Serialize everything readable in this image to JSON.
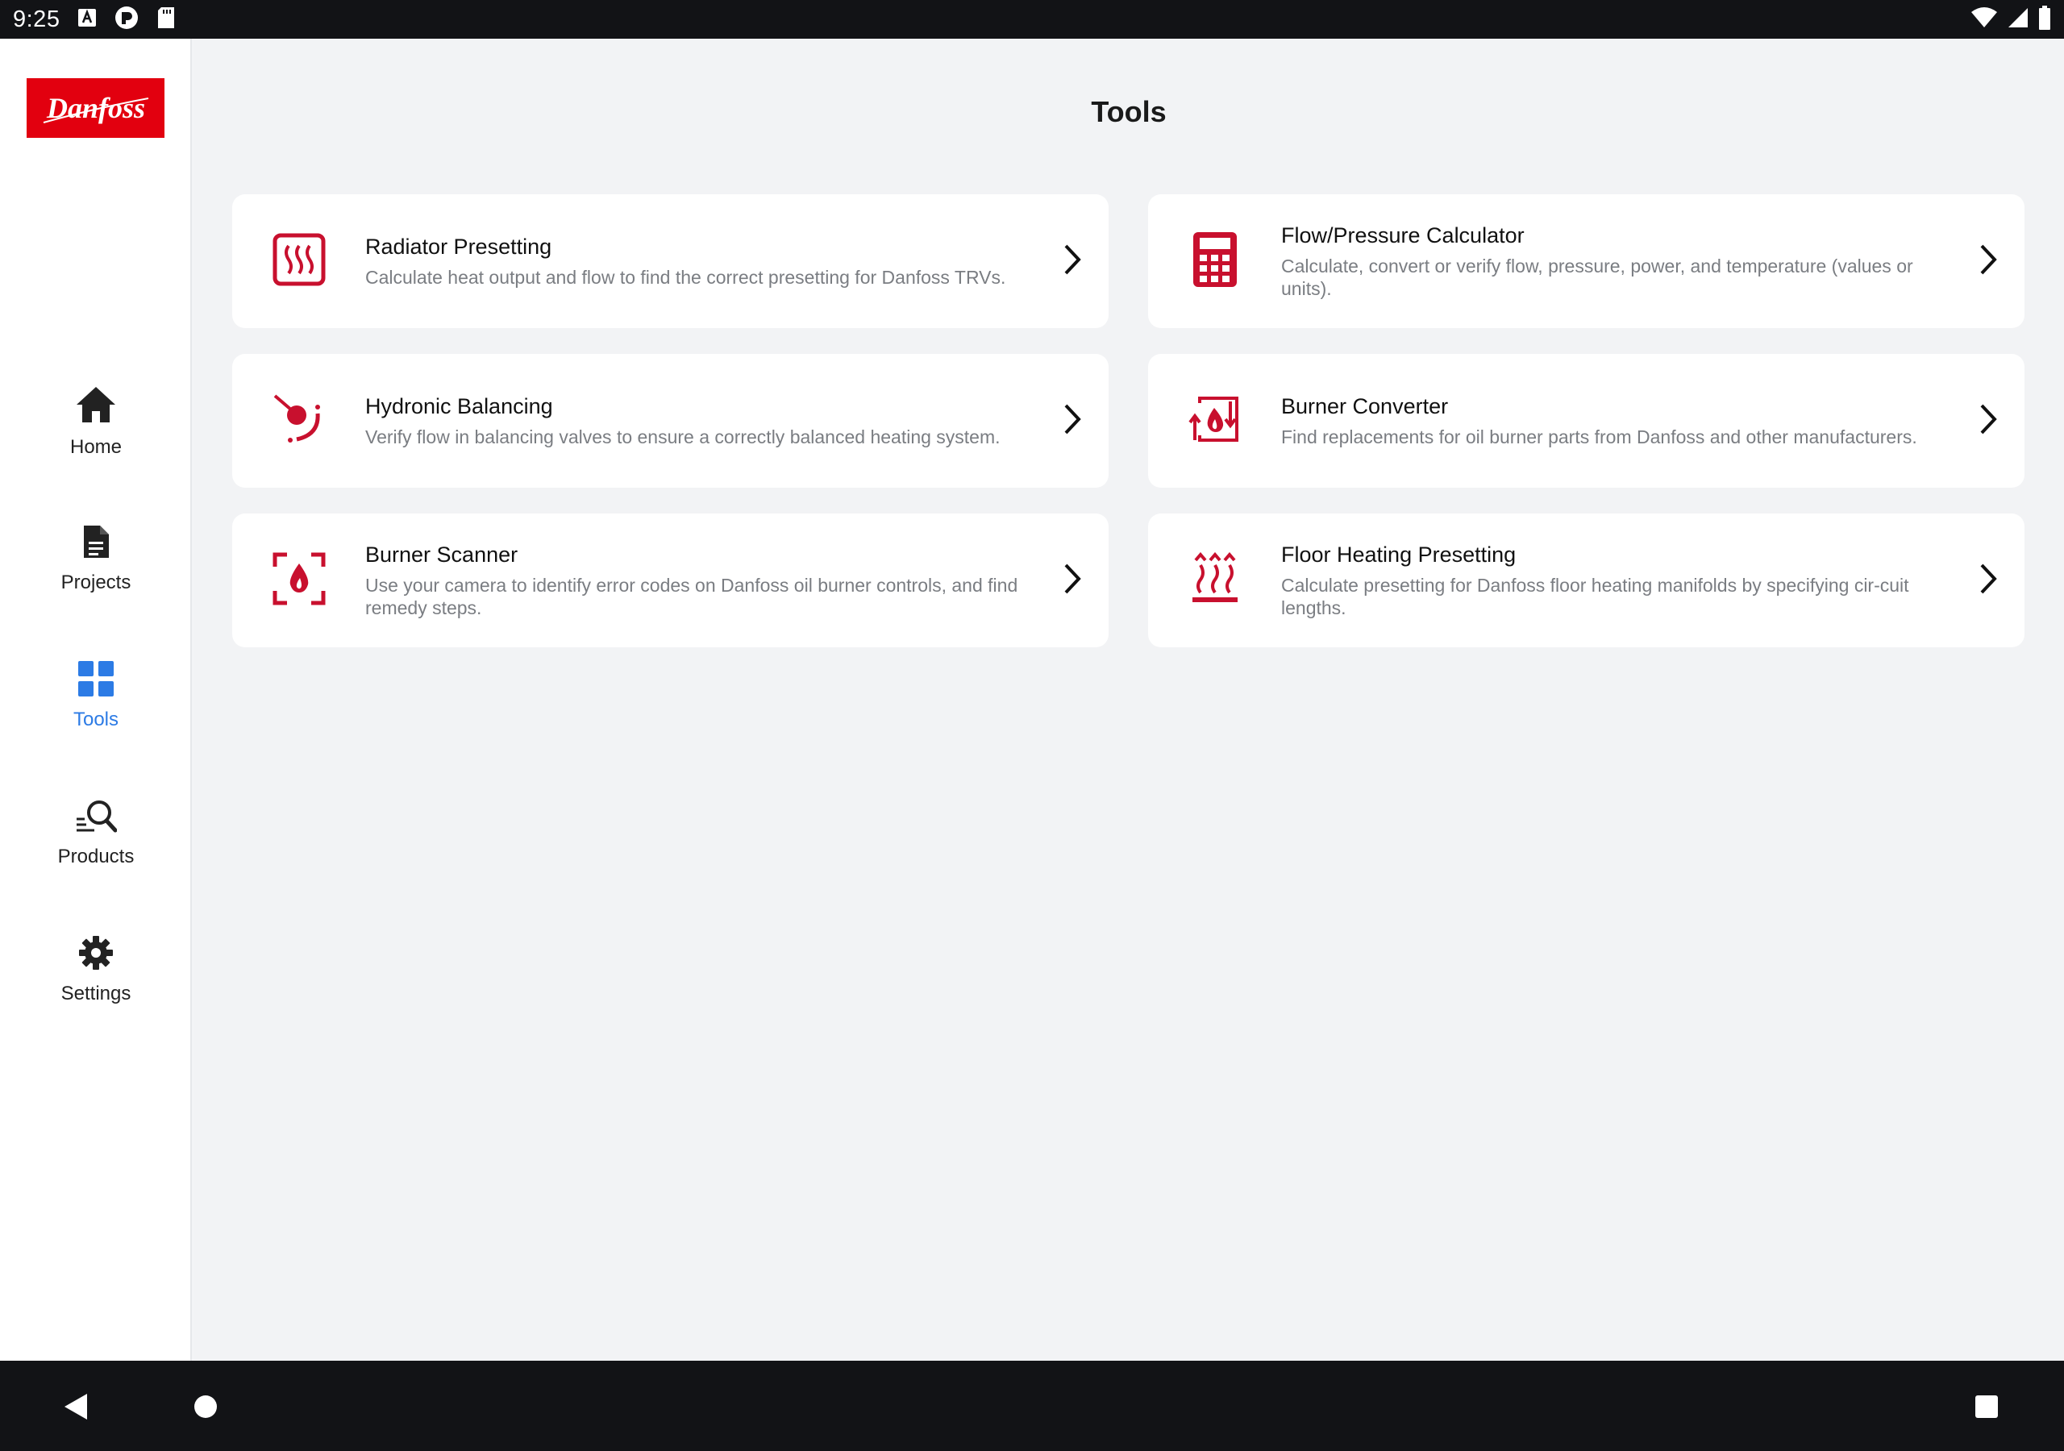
{
  "status_bar": {
    "time": "9:25"
  },
  "sidebar": {
    "logo_text": "Danfoss",
    "items": [
      {
        "label": "Home",
        "icon": "home-icon",
        "active": false
      },
      {
        "label": "Projects",
        "icon": "document-icon",
        "active": false
      },
      {
        "label": "Tools",
        "icon": "grid-icon",
        "active": true
      },
      {
        "label": "Products",
        "icon": "search-icon",
        "active": false
      },
      {
        "label": "Settings",
        "icon": "gear-icon",
        "active": false
      }
    ]
  },
  "main": {
    "title": "Tools",
    "tools": [
      {
        "title": "Radiator Presetting",
        "description": "Calculate heat output and flow to find the correct presetting for Danfoss TRVs.",
        "icon": "radiator-icon"
      },
      {
        "title": "Flow/Pressure Calculator",
        "description": "Calculate, convert or verify flow, pressure, power, and temperature (values or units).",
        "icon": "calculator-icon"
      },
      {
        "title": "Hydronic Balancing",
        "description": "Verify flow in balancing valves to ensure a correctly balanced heating system.",
        "icon": "balancing-icon"
      },
      {
        "title": "Burner Converter",
        "description": "Find replacements for oil burner parts from Danfoss and other manufacturers.",
        "icon": "burner-converter-icon"
      },
      {
        "title": "Burner Scanner",
        "description": "Use your camera to identify error codes on Danfoss oil burner controls, and find remedy steps.",
        "icon": "burner-scanner-icon"
      },
      {
        "title": "Floor Heating Presetting",
        "description": "Calculate presetting for Danfoss floor heating manifolds by specifying cir-cuit lengths.",
        "icon": "floor-heating-icon"
      }
    ]
  },
  "colors": {
    "brand_red": "#e2000f",
    "icon_red": "#c8102e",
    "active_blue": "#2c7be5"
  }
}
